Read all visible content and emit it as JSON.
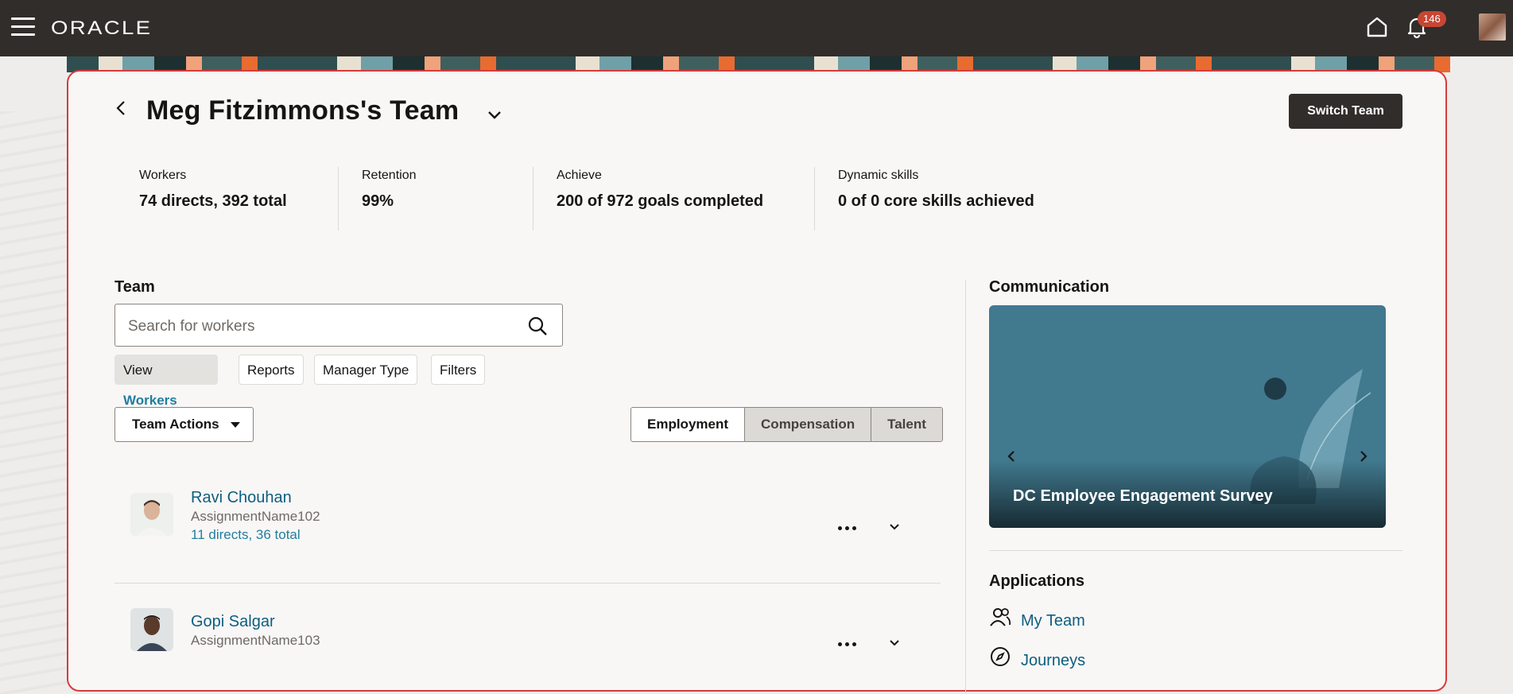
{
  "header": {
    "logo": "ORACLE",
    "notification_count": "146"
  },
  "page": {
    "title": "Meg Fitzimmons's Team",
    "switch_team_label": "Switch Team"
  },
  "metrics": [
    {
      "label": "Workers",
      "value": "74 directs, 392 total"
    },
    {
      "label": "Retention",
      "value": "99%"
    },
    {
      "label": "Achieve",
      "value": "200 of 972 goals completed"
    },
    {
      "label": "Dynamic skills",
      "value": "0 of 0 core skills achieved"
    }
  ],
  "team": {
    "heading": "Team",
    "search_placeholder": "Search for workers",
    "chips": {
      "view_prefix": "View",
      "view_value": "Workers",
      "reports": "Reports",
      "manager_type": "Manager Type",
      "filters": "Filters"
    },
    "team_actions_label": "Team Actions",
    "tabs": [
      "Employment",
      "Compensation",
      "Talent"
    ],
    "people": [
      {
        "name": "Ravi Chouhan",
        "assignment": "AssignmentName102",
        "reports": "11 directs, 36 total"
      },
      {
        "name": "Gopi Salgar",
        "assignment": "AssignmentName103"
      }
    ]
  },
  "communication": {
    "heading": "Communication",
    "slide_title": "DC Employee Engagement Survey"
  },
  "applications": {
    "heading": "Applications",
    "items": [
      "My Team",
      "Journeys"
    ]
  },
  "colors": {
    "topbar": "#312d2a",
    "link": "#0d5e7f",
    "badge": "#c74634",
    "card_border": "#d63b3b"
  }
}
